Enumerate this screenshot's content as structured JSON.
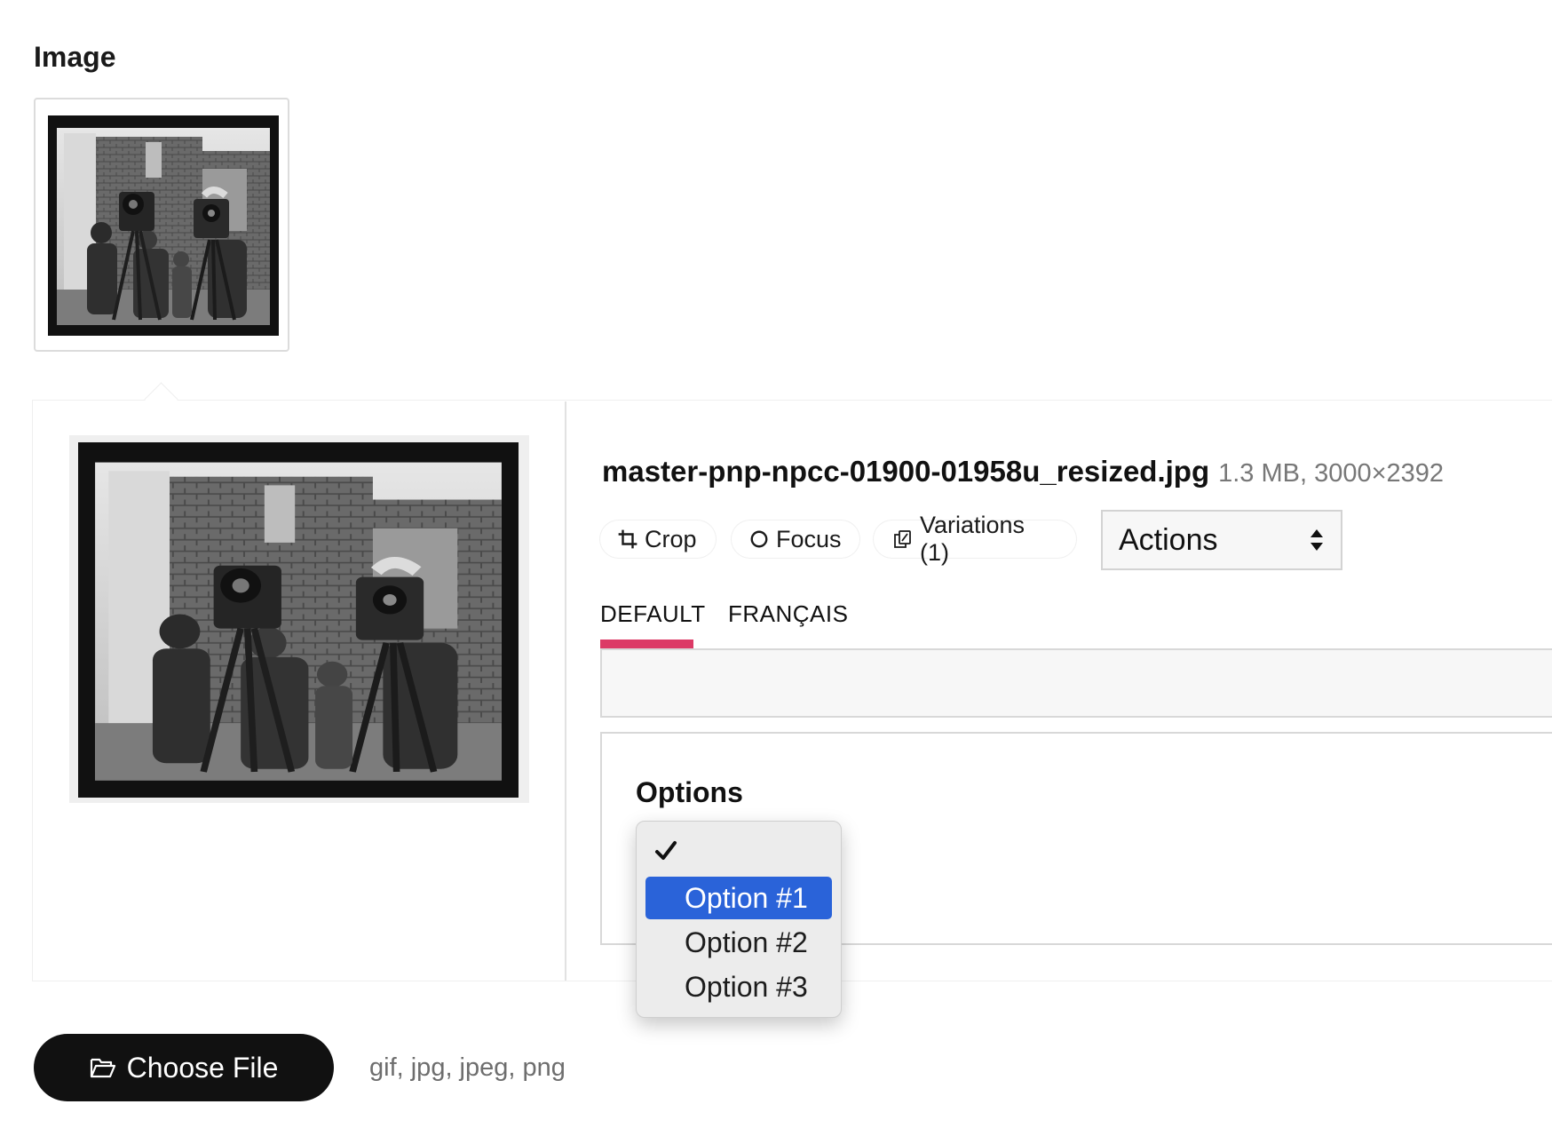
{
  "section": {
    "label": "Image"
  },
  "file": {
    "name": "master-pnp-npcc-01900-01958u_resized.jpg",
    "meta": "1.3 MB, 3000×2392"
  },
  "toolbar": {
    "crop_label": "Crop",
    "focus_label": "Focus",
    "variations_label": "Variations (1)",
    "actions_label": "Actions"
  },
  "tabs": [
    {
      "label": "DEFAULT",
      "active": true
    },
    {
      "label": "FRANÇAIS",
      "active": false
    }
  ],
  "options": {
    "label": "Options",
    "items": [
      {
        "label": "Option #1",
        "highlighted": true
      },
      {
        "label": "Option #2",
        "highlighted": false
      },
      {
        "label": "Option #3",
        "highlighted": false
      }
    ]
  },
  "upload": {
    "button_label": "Choose File",
    "allowed_types": "gif, jpg, jpeg, png"
  },
  "colors": {
    "tab_accent": "#dc3a66",
    "dropdown_highlight": "#2a63d9",
    "primary_button": "#111111"
  },
  "icons": {
    "crop": "crop-icon",
    "focus": "focus-icon",
    "variations": "variations-icon",
    "actions": "updown-arrows-icon",
    "check": "checkmark-icon",
    "upload": "folder-open-icon"
  }
}
